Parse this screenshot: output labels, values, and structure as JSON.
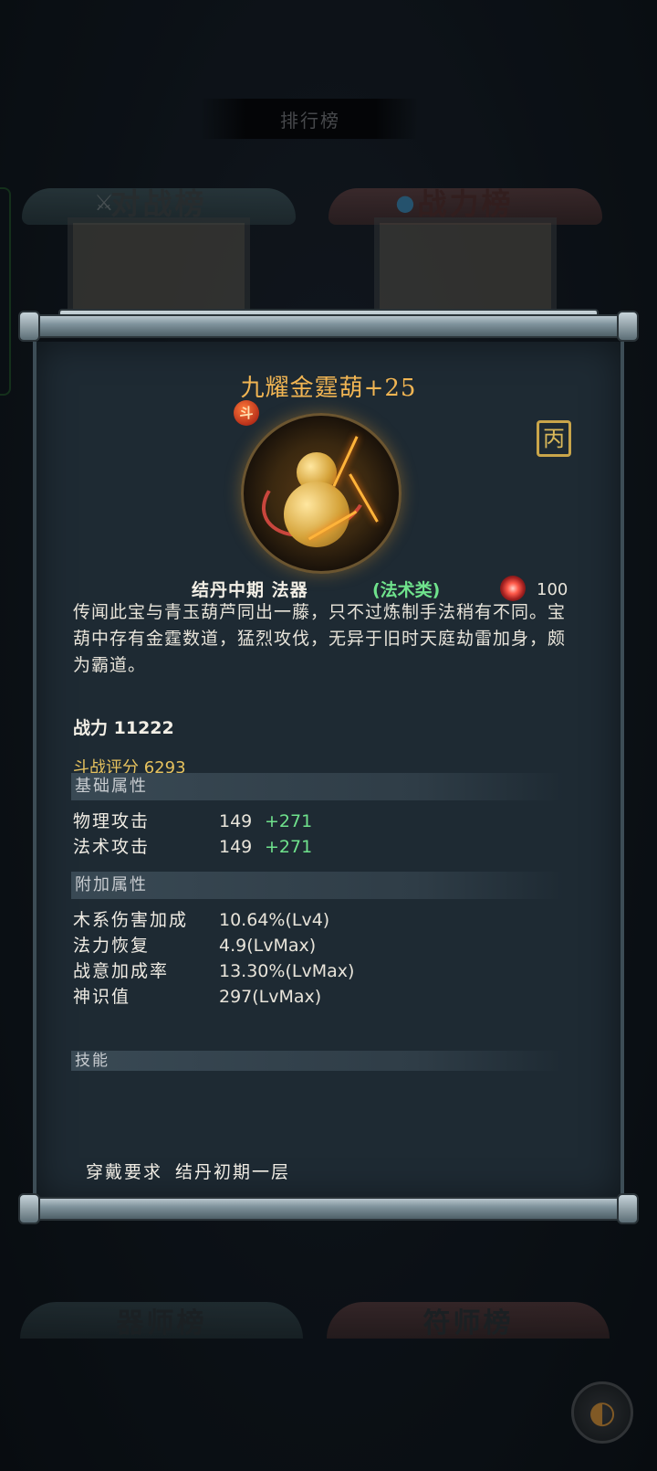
{
  "background": {
    "title": "排行榜",
    "boards": [
      {
        "label": "对战榜",
        "icon": "crossed-swords-icon"
      },
      {
        "label": "战力榜",
        "icon": "water-drop-icon"
      }
    ],
    "bottom_boards": [
      {
        "label": "器师榜"
      },
      {
        "label": "符师榜"
      }
    ]
  },
  "item": {
    "name": "九耀金霆葫+25",
    "badge": "斗",
    "seal": "丙",
    "realm": "结丹中期 法器",
    "category": "(法术类)",
    "slot_value": "100",
    "description": "传闻此宝与青玉葫芦同出一藤，只不过炼制手法稍有不同。宝葫中存有金霆数道，猛烈攻伐，无异于旧时天庭劫雷加身，颇为霸道。",
    "power_label": "战力",
    "power_value": "11222",
    "fight_score_label": "斗战评分",
    "fight_score_value": "6293",
    "base_section": "基础属性",
    "base_attrs": [
      {
        "name": "物理攻击",
        "value": "149",
        "bonus": "+271"
      },
      {
        "name": "法术攻击",
        "value": "149",
        "bonus": "+271"
      }
    ],
    "extra_section": "附加属性",
    "extra_attrs": [
      {
        "name": "木系伤害加成",
        "value": "10.64%(Lv4)"
      },
      {
        "name": "法力恢复",
        "value": "4.9(LvMax)"
      },
      {
        "name": "战意加成率",
        "value": "13.30%(LvMax)"
      },
      {
        "name": "神识值",
        "value": "297(LvMax)"
      }
    ],
    "skill_section": "技能",
    "requirement_label": "穿戴要求",
    "requirement_value": "结丹初期一层"
  },
  "colors": {
    "title": "#f1b553",
    "category": "#6fe28c",
    "fight_score": "#e6c25e",
    "bonus": "#6fe28c"
  }
}
